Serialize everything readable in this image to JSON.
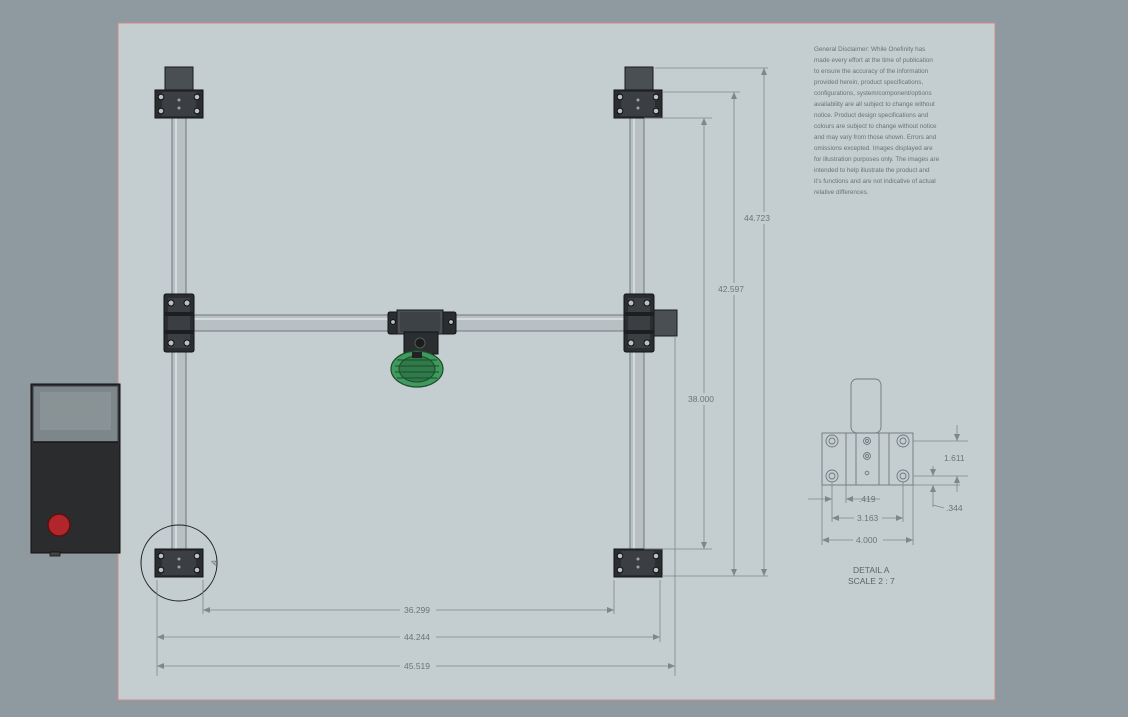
{
  "disclaimer_lines": [
    "General Disclaimer: While Onefinity has",
    "made every effort at the time of publication",
    "to ensure the accuracy of the information",
    "provided herein, product specifications,",
    "configurations, system/component/options",
    "availability are all subject to change without",
    "notice. Product design specifications and",
    "colours are subject to change without notice",
    "and may vary from those shown. Errors and",
    "omissions excepted. Images displayed  are",
    "for illustration purposes only. The images are",
    "intended to help illustrate the product and",
    "it's functions and are not indicative of actual",
    "relative differences."
  ],
  "dimensions": {
    "overall_y": "44.723",
    "rail_y": "42.597",
    "travel_y": "38.000",
    "travel_x": "36.299",
    "rail_x": "44.244",
    "overall_x": "45.519"
  },
  "detail": {
    "marker": "A",
    "title": "DETAIL A",
    "scale": "SCALE 2 : 7",
    "dim_height": "1.611",
    "dim_offset": ".344",
    "dim_hole": ".419",
    "dim_inner": "3.163",
    "dim_width": "4.000"
  },
  "colors": {
    "background": "#8e9a9f",
    "sheet": "#c4cdd0",
    "sheet_border": "#d28a8a",
    "router_green": "#3f9a5e",
    "estop_red": "#b0262a",
    "block": "#2b2e31"
  }
}
